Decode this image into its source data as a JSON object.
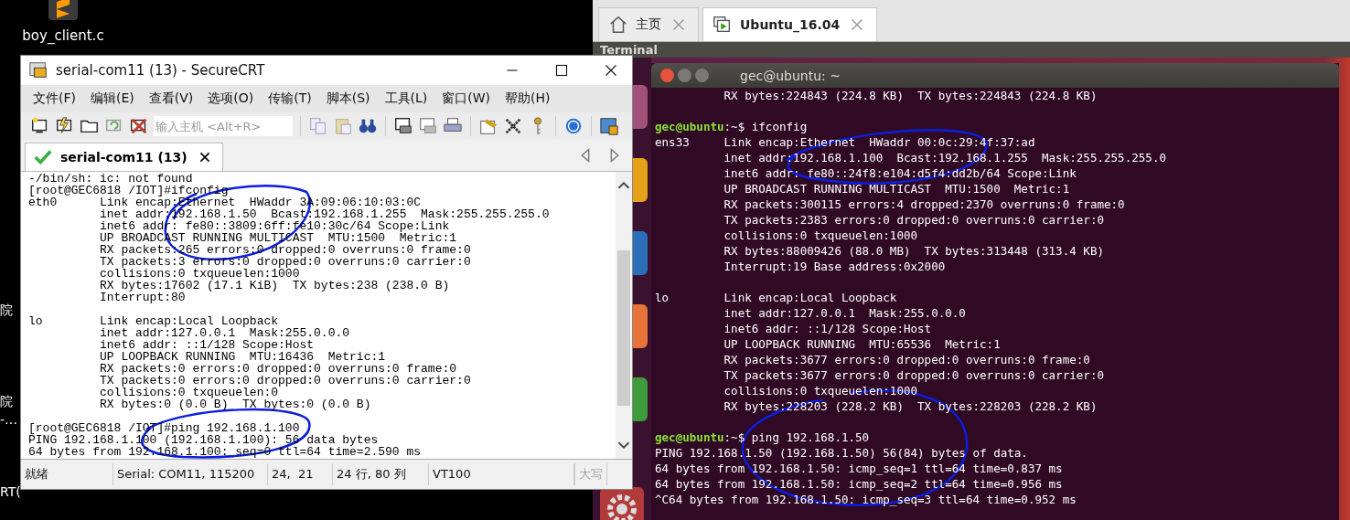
{
  "desktop": {
    "icons": [
      {
        "label": "boy_client.c"
      }
    ],
    "cut_labels": [
      "院",
      "院",
      "-…",
      "RT("
    ]
  },
  "securecrt": {
    "title": "serial-com11 (13) - SecureCRT",
    "menu": [
      "文件(F)",
      "编辑(E)",
      "查看(V)",
      "选项(O)",
      "传输(T)",
      "脚本(S)",
      "工具(L)",
      "窗口(W)",
      "帮助(H)"
    ],
    "host_field": {
      "placeholder": "输入主机 <Alt+R>"
    },
    "tabs": [
      {
        "label": "serial-com11 (13)",
        "selected": true,
        "connected": true
      }
    ],
    "lines": [
      {
        "kind": "output",
        "text": "-/bin/sh: ic: not found"
      },
      {
        "kind": "output",
        "text": "[root@GEC6818 /IOT]#ifconfig"
      },
      {
        "kind": "output",
        "text": "eth0      Link encap:Ethernet  HWaddr 3A:09:06:10:03:0C"
      },
      {
        "kind": "output",
        "text": "          inet addr:192.168.1.50  Bcast:192.168.1.255  Mask:255.255.255.0"
      },
      {
        "kind": "output",
        "text": "          inet6 addr: fe80::3809:6ff:fe10:30c/64 Scope:Link"
      },
      {
        "kind": "output",
        "text": "          UP BROADCAST RUNNING MULTICAST  MTU:1500  Metric:1"
      },
      {
        "kind": "output",
        "text": "          RX packets:265 errors:0 dropped:0 overruns:0 frame:0"
      },
      {
        "kind": "output",
        "text": "          TX packets:3 errors:0 dropped:0 overruns:0 carrier:0"
      },
      {
        "kind": "output",
        "text": "          collisions:0 txqueuelen:1000"
      },
      {
        "kind": "output",
        "text": "          RX bytes:17602 (17.1 KiB)  TX bytes:238 (238.0 B)"
      },
      {
        "kind": "output",
        "text": "          Interrupt:80"
      },
      {
        "kind": "blank"
      },
      {
        "kind": "output",
        "text": "lo        Link encap:Local Loopback"
      },
      {
        "kind": "output",
        "text": "          inet addr:127.0.0.1  Mask:255.0.0.0"
      },
      {
        "kind": "output",
        "text": "          inet6 addr: ::1/128 Scope:Host"
      },
      {
        "kind": "output",
        "text": "          UP LOOPBACK RUNNING  MTU:16436  Metric:1"
      },
      {
        "kind": "output",
        "text": "          RX packets:0 errors:0 dropped:0 overruns:0 frame:0"
      },
      {
        "kind": "output",
        "text": "          TX packets:0 errors:0 dropped:0 overruns:0 carrier:0"
      },
      {
        "kind": "output",
        "text": "          collisions:0 txqueuelen:0"
      },
      {
        "kind": "output",
        "text": "          RX bytes:0 (0.0 B)  TX bytes:0 (0.0 B)"
      },
      {
        "kind": "blank"
      },
      {
        "kind": "output",
        "text": "[root@GEC6818 /IOT]#ping 192.168.1.100"
      },
      {
        "kind": "output",
        "text": "PING 192.168.1.100 (192.168.1.100): 56 data bytes"
      },
      {
        "kind": "output",
        "text": "64 bytes from 192.168.1.100: seq=0 ttl=64 time=2.590 ms"
      }
    ],
    "status_bar": [
      {
        "text": "就绪",
        "disabled": false
      },
      {
        "text": "Serial: COM11, 115200",
        "disabled": false
      },
      {
        "text": "24,  21",
        "disabled": false
      },
      {
        "text": "24 行, 80 列",
        "disabled": false
      },
      {
        "text": "VT100",
        "disabled": false
      },
      {
        "text": "大写",
        "disabled": true
      }
    ]
  },
  "vmware": {
    "tabs": [
      {
        "label": "主页",
        "selected": false
      },
      {
        "label": "Ubuntu_16.04",
        "selected": true
      }
    ],
    "panel_title": "Terminal",
    "terminal": {
      "title": "gec@ubuntu: ~",
      "lines": [
        {
          "kind": "output",
          "text": "          RX bytes:224843 (224.8 KB)  TX bytes:224843 (224.8 KB)"
        },
        {
          "kind": "blank"
        },
        {
          "kind": "prompt",
          "host": "gec@ubuntu",
          "rest": ":~$ ifconfig"
        },
        {
          "kind": "output",
          "text": "ens33     Link encap:Ethernet  HWaddr 00:0c:29:4f:37:ad"
        },
        {
          "kind": "output",
          "text": "          inet addr:192.168.1.100  Bcast:192.168.1.255  Mask:255.255.255.0"
        },
        {
          "kind": "output",
          "text": "          inet6 addr: fe80::24f8:e104:d5f4:dd2b/64 Scope:Link"
        },
        {
          "kind": "output",
          "text": "          UP BROADCAST RUNNING MULTICAST  MTU:1500  Metric:1"
        },
        {
          "kind": "output",
          "text": "          RX packets:300115 errors:4 dropped:2370 overruns:0 frame:0"
        },
        {
          "kind": "output",
          "text": "          TX packets:2383 errors:0 dropped:0 overruns:0 carrier:0"
        },
        {
          "kind": "output",
          "text": "          collisions:0 txqueuelen:1000"
        },
        {
          "kind": "output",
          "text": "          RX bytes:88009426 (88.0 MB)  TX bytes:313448 (313.4 KB)"
        },
        {
          "kind": "output",
          "text": "          Interrupt:19 Base address:0x2000"
        },
        {
          "kind": "blank"
        },
        {
          "kind": "output",
          "text": "lo        Link encap:Local Loopback"
        },
        {
          "kind": "output",
          "text": "          inet addr:127.0.0.1  Mask:255.0.0.0"
        },
        {
          "kind": "output",
          "text": "          inet6 addr: ::1/128 Scope:Host"
        },
        {
          "kind": "output",
          "text": "          UP LOOPBACK RUNNING  MTU:65536  Metric:1"
        },
        {
          "kind": "output",
          "text": "          RX packets:3677 errors:0 dropped:0 overruns:0 frame:0"
        },
        {
          "kind": "output",
          "text": "          TX packets:3677 errors:0 dropped:0 overruns:0 carrier:0"
        },
        {
          "kind": "output",
          "text": "          collisions:0 txqueuelen:1000"
        },
        {
          "kind": "output",
          "text": "          RX bytes:228203 (228.2 KB)  TX bytes:228203 (228.2 KB)"
        },
        {
          "kind": "blank"
        },
        {
          "kind": "prompt",
          "host": "gec@ubuntu",
          "rest": ":~$ ping 192.168.1.50"
        },
        {
          "kind": "output",
          "text": "PING 192.168.1.50 (192.168.1.50) 56(84) bytes of data."
        },
        {
          "kind": "output",
          "text": "64 bytes from 192.168.1.50: icmp_seq=1 ttl=64 time=0.837 ms"
        },
        {
          "kind": "output",
          "text": "64 bytes from 192.168.1.50: icmp_seq=2 ttl=64 time=0.956 ms"
        },
        {
          "kind": "output",
          "text": "^C64 bytes from 192.168.1.50: icmp_seq=3 ttl=64 time=0.952 ms"
        }
      ]
    }
  }
}
